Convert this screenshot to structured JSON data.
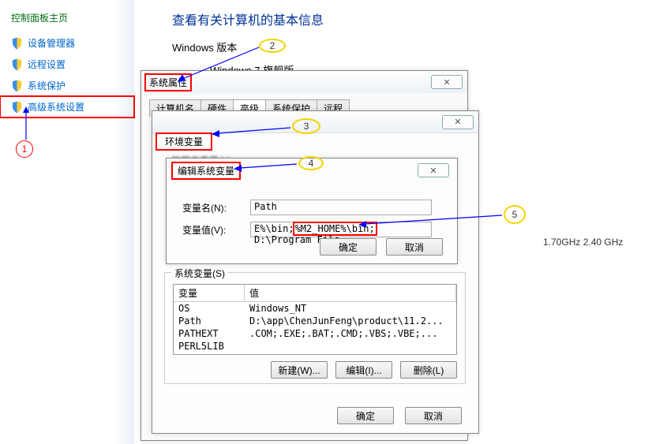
{
  "sidebar": {
    "title": "控制面板主页",
    "items": [
      {
        "label": "设备管理器"
      },
      {
        "label": "远程设置"
      },
      {
        "label": "系统保护"
      },
      {
        "label": "高级系统设置"
      }
    ]
  },
  "main": {
    "title": "查看有关计算机的基本信息",
    "edition_label": "Windows 版本",
    "edition_value": "Windows 7 旗舰版",
    "cpu": "1.70GHz  2.40 GHz"
  },
  "dlg_sysprop": {
    "title": "系统属性",
    "tabs": [
      "计算机名",
      "硬件",
      "高级",
      "系统保护",
      "远程"
    ],
    "close": "✕"
  },
  "dlg_env": {
    "title": "环境变量",
    "close": "✕",
    "user_group_caption": "的用户变量(U)"
  },
  "dlg_edit": {
    "title": "编辑系统变量",
    "close": "✕",
    "name_label": "变量名(N):",
    "name_value": "Path",
    "value_label": "变量值(V):",
    "value_pre": "E%\\bin;",
    "value_hl": "%M2_HOME%\\bin;",
    "value_post": "D:\\Program File",
    "ok": "确定",
    "cancel": "取消"
  },
  "sysvars": {
    "legend": "系统变量(S)",
    "col_name": "变量",
    "col_val": "值",
    "rows": [
      {
        "name": "OS",
        "val": "Windows_NT"
      },
      {
        "name": "Path",
        "val": "D:\\app\\ChenJunFeng\\product\\11.2..."
      },
      {
        "name": "PATHEXT",
        "val": ".COM;.EXE;.BAT;.CMD;.VBS;.VBE;..."
      },
      {
        "name": "PERL5LIB",
        "val": ""
      }
    ],
    "btn_new": "新建(W)...",
    "btn_edit": "编辑(I)...",
    "btn_del": "删除(L)"
  },
  "env_bottom": {
    "ok": "确定",
    "cancel": "取消"
  },
  "anno": {
    "n1": "1",
    "n2": "2",
    "n3": "3",
    "n4": "4",
    "n5": "5"
  }
}
